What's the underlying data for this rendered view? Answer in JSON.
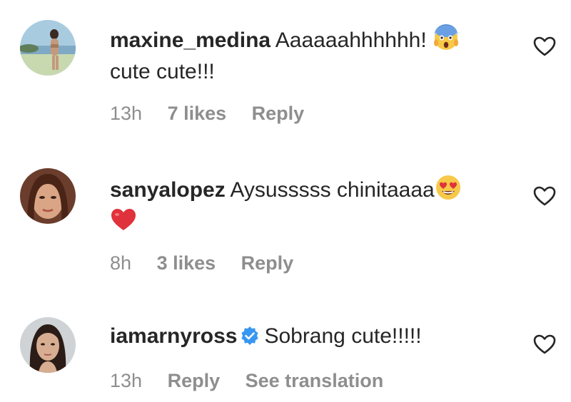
{
  "comments": [
    {
      "username": "maxine_medina",
      "text_line1": "Aaaaaahhhhhh!",
      "emoji1": "face-screaming-in-fear-icon",
      "text_line2": "cute cute!!!",
      "time": "13h",
      "likes": "7 likes",
      "reply": "Reply"
    },
    {
      "username": "sanyalopez",
      "text_line1": "Aysusssss chinitaaaa",
      "emoji1": "smiling-face-with-heart-eyes-icon",
      "emoji2": "red-heart-icon",
      "time": "8h",
      "likes": "3 likes",
      "reply": "Reply"
    },
    {
      "username": "iamarnyross",
      "verified": true,
      "text_line1": "Sobrang cute!!!!!",
      "time": "13h",
      "reply": "Reply",
      "translation": "See translation"
    }
  ],
  "colors": {
    "text": "#262626",
    "meta": "#8e8e8e",
    "verified": "#3897f0",
    "heart_emoji": "#e0323c"
  }
}
